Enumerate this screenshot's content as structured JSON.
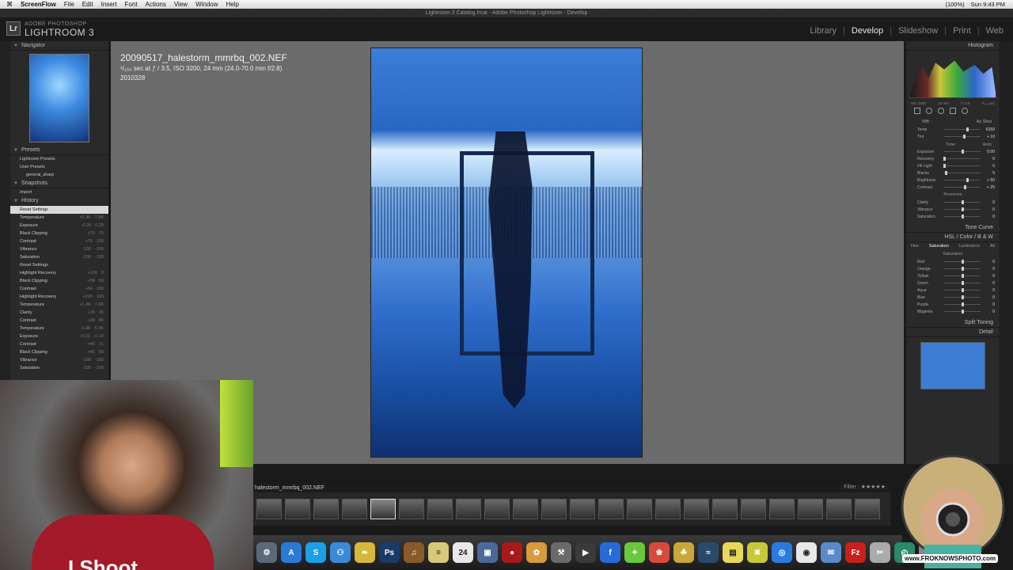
{
  "menubar": {
    "apple": "⌘",
    "app": "ScreenFlow",
    "items": [
      "File",
      "Edit",
      "Insert",
      "Font",
      "Actions",
      "View",
      "Window",
      "Help"
    ],
    "battery": "(100%)",
    "clock": "Sun 9:43 PM"
  },
  "window_title": "Lightroom 3 Catalog.lrcat - Adobe Photoshop Lightroom - Develop",
  "lightroom": {
    "brand_small": "ADOBE PHOTOSHOP",
    "brand_big": "LIGHTROOM 3",
    "modules": [
      "Library",
      "Develop",
      "Slideshow",
      "Print",
      "Web"
    ],
    "active_module": "Develop"
  },
  "left_panel": {
    "navigator": "Navigator",
    "presets": "Presets",
    "preset_items": [
      "Lightroom Presets",
      "User Presets",
      "general_sharp"
    ],
    "snapshots": "Snapshots",
    "snapshot_items": [
      "Import"
    ],
    "history": "History",
    "history_items": [
      {
        "label": "Reset Settings",
        "a": "",
        "b": ""
      },
      {
        "label": "Temperature",
        "a": "+5.3K",
        "b": "7.5K"
      },
      {
        "label": "Exposure",
        "a": "-0.20",
        "b": "0.20"
      },
      {
        "label": "Black Clipping",
        "a": "+70",
        "b": "70"
      },
      {
        "label": "Contrast",
        "a": "+75",
        "b": "100"
      },
      {
        "label": "Vibrance",
        "a": "-100",
        "b": "-100"
      },
      {
        "label": "Saturation",
        "a": "-100",
        "b": "-100"
      },
      {
        "label": "Reset Settings",
        "a": "",
        "b": ""
      },
      {
        "label": "Highlight Recovery",
        "a": "+100",
        "b": "0"
      },
      {
        "label": "Black Clipping",
        "a": "+59",
        "b": "59"
      },
      {
        "label": "Contrast",
        "a": "+54",
        "b": "100"
      },
      {
        "label": "Highlight Recovery",
        "a": "+100",
        "b": "100"
      },
      {
        "label": "Temperature",
        "a": "+1.3K",
        "b": "7.6K"
      },
      {
        "label": "Clarity",
        "a": "+15",
        "b": "15"
      },
      {
        "label": "Contrast",
        "a": "+38",
        "b": "86"
      },
      {
        "label": "Temperature",
        "a": "-1.4K",
        "b": "6.3K"
      },
      {
        "label": "Exposure",
        "a": "-0.10",
        "b": "-0.10"
      },
      {
        "label": "Contrast",
        "a": "+45",
        "b": "71"
      },
      {
        "label": "Black Clipping",
        "a": "+45",
        "b": "50"
      },
      {
        "label": "Vibrance",
        "a": "-100",
        "b": "-100"
      },
      {
        "label": "Saturation",
        "a": "-100",
        "b": "-100"
      }
    ]
  },
  "photo_info": {
    "filename": "20090517_halestorm_mmrbq_002.NEF",
    "exif": "¹/₂₅₀ sec at ƒ / 3.5, ISO 3200, 24 mm (24.0-70.0 mm f/2.8)",
    "number": "2010328"
  },
  "right_panel": {
    "histogram": "Histogram",
    "hist_meta": [
      "ISO 3200",
      "24 mm",
      "f / 3.5",
      "¹/₂₅₀ sec"
    ],
    "wb_label": "WB :",
    "wb_value": "As Shot",
    "basic_sliders": [
      {
        "label": "Temp",
        "value": "6150",
        "pos": 0.62
      },
      {
        "label": "Tint",
        "value": "+ 10",
        "pos": 0.55
      }
    ],
    "tone_label": "Tone",
    "tone_auto": "Auto",
    "tone_sliders": [
      {
        "label": "Exposure",
        "value": "0.00",
        "pos": 0.5
      },
      {
        "label": "Recovery",
        "value": "0",
        "pos": 0.0
      },
      {
        "label": "Fill Light",
        "value": "0",
        "pos": 0.0
      },
      {
        "label": "Blacks",
        "value": "5",
        "pos": 0.05
      },
      {
        "label": "Brightness",
        "value": "+ 50",
        "pos": 0.62
      },
      {
        "label": "Contrast",
        "value": "+ 25",
        "pos": 0.56
      }
    ],
    "presence_label": "Presence",
    "presence_sliders": [
      {
        "label": "Clarity",
        "value": "0",
        "pos": 0.5
      },
      {
        "label": "Vibrance",
        "value": "0",
        "pos": 0.5
      },
      {
        "label": "Saturation",
        "value": "0",
        "pos": 0.5
      }
    ],
    "tone_curve": "Tone Curve",
    "hsl_header": "HSL / Color / B & W",
    "hsl_tabs": [
      "Hue",
      "Saturation",
      "Luminance",
      "All"
    ],
    "hsl_active": "Saturation",
    "saturation_label": "Saturation",
    "hsl_sliders": [
      {
        "label": "Red",
        "value": "0"
      },
      {
        "label": "Orange",
        "value": "0"
      },
      {
        "label": "Yellow",
        "value": "0"
      },
      {
        "label": "Green",
        "value": "0"
      },
      {
        "label": "Aqua",
        "value": "0"
      },
      {
        "label": "Blue",
        "value": "0"
      },
      {
        "label": "Purple",
        "value": "0"
      },
      {
        "label": "Magenta",
        "value": "0"
      }
    ],
    "split_toning": "Split Toning",
    "detail": "Detail"
  },
  "filmstrip": {
    "current": "halestorm_mmrbq_002.NEF",
    "filter_label": "Filter :",
    "thumb_count": 22,
    "selected_index": 4
  },
  "dock": {
    "icons": [
      {
        "name": "system-preferences-icon",
        "char": "⚙",
        "color": "#5a6a7a"
      },
      {
        "name": "app-store-icon",
        "char": "A",
        "color": "#2a7ad8"
      },
      {
        "name": "skype-icon",
        "char": "S",
        "color": "#1aa0e6"
      },
      {
        "name": "finder-icon",
        "char": "⚇",
        "color": "#3a8ad8"
      },
      {
        "name": "bird-icon",
        "char": "❧",
        "color": "#d8b83a"
      },
      {
        "name": "photoshop-icon",
        "char": "Ps",
        "color": "#1a3a6a"
      },
      {
        "name": "guitar-icon",
        "char": "♫",
        "color": "#8a5a2a"
      },
      {
        "name": "notes-icon",
        "char": "≡",
        "color": "#d8c87a"
      },
      {
        "name": "calendar-icon",
        "char": "24",
        "color": "#e8e8e8"
      },
      {
        "name": "preview-icon",
        "char": "▣",
        "color": "#4a6a9a"
      },
      {
        "name": "photo-booth-icon",
        "char": "●",
        "color": "#a81a1a"
      },
      {
        "name": "iphoto-icon",
        "char": "✿",
        "color": "#d89a3a"
      },
      {
        "name": "tools-icon",
        "char": "⚒",
        "color": "#6a6a6a"
      },
      {
        "name": "film-icon",
        "char": "▶",
        "color": "#3a3a3a"
      },
      {
        "name": "flickr-icon",
        "char": "f",
        "color": "#2a6ad8"
      },
      {
        "name": "puzzle-icon",
        "char": "✦",
        "color": "#6ac83a"
      },
      {
        "name": "paw-icon",
        "char": "❀",
        "color": "#d84a3a"
      },
      {
        "name": "pineapple-icon",
        "char": "☘",
        "color": "#c8a83a"
      },
      {
        "name": "activity-icon",
        "char": "≈",
        "color": "#2a4a6a"
      },
      {
        "name": "stickies-icon",
        "char": "▤",
        "color": "#e8d85a"
      },
      {
        "name": "utility-icon",
        "char": "✖",
        "color": "#c8c83a"
      },
      {
        "name": "browser-icon",
        "char": "◎",
        "color": "#2a7ae0"
      },
      {
        "name": "dvd-icon",
        "char": "◉",
        "color": "#e8e8e8"
      },
      {
        "name": "mail-icon",
        "char": "✉",
        "color": "#5a8ac8"
      },
      {
        "name": "filezilla-icon",
        "char": "Fz",
        "color": "#c8201a"
      },
      {
        "name": "script-icon",
        "char": "✂",
        "color": "#aaaaaa"
      },
      {
        "name": "time-machine-icon",
        "char": "◴",
        "color": "#2a8a6a"
      },
      {
        "name": "downloads-icon",
        "char": "⬇",
        "color": "#8a8a8a"
      }
    ]
  },
  "webcam_shirt_text": "I Shoot",
  "badge_text": "www.FROKNOWSPHOTO.com"
}
